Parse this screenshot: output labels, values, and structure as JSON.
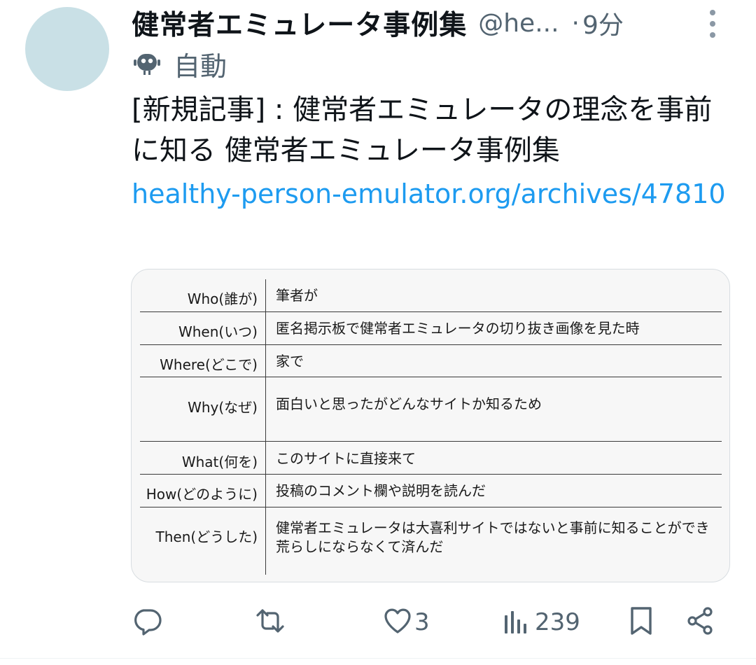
{
  "tweet": {
    "display_name": "健常者エミュレータ事例集",
    "handle": "@he...",
    "separator": "·",
    "time": "9分",
    "automated_label": "自動",
    "text": "[新規記事] : 健常者エミュレータの理念を事前に知る 健常者エミュレータ事例集",
    "link": "healthy-person-emulator.org/archives/47810"
  },
  "card_table": {
    "rows": [
      {
        "label": "Who(誰が)",
        "value": "筆者が"
      },
      {
        "label": "When(いつ)",
        "value": "匿名掲示板で健常者エミュレータの切り抜き画像を見た時"
      },
      {
        "label": "Where(どこで)",
        "value": "家で"
      },
      {
        "label": "Why(なぜ)",
        "value": "面白いと思ったがどんなサイトか知るため"
      },
      {
        "label": "What(何を)",
        "value": "このサイトに直接来て"
      },
      {
        "label": "How(どのように)",
        "value": "投稿のコメント欄や説明を読んだ"
      },
      {
        "label": "Then(どうした)",
        "value": "健常者エミュレータは大喜利サイトではないと事前に知ることができ荒らしにならなくて済んだ"
      }
    ]
  },
  "actions": {
    "reply_count": "",
    "retweet_count": "",
    "like_count": "3",
    "views_count": "239"
  },
  "icons": {
    "more": "more-vertical-icon",
    "automated": "robot-icon",
    "reply": "reply-icon",
    "retweet": "retweet-icon",
    "like": "heart-icon",
    "views": "views-chart-icon",
    "bookmark": "bookmark-icon",
    "share": "share-icon"
  },
  "colors": {
    "link": "#1d9bf0",
    "secondary_text": "#536471",
    "avatar": "#c9e0e6"
  }
}
